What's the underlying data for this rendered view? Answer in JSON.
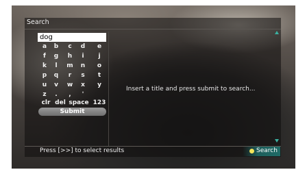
{
  "colors": {
    "accent": "#3bb0a0",
    "submit_gradient": "#8a8a8a",
    "search_dot": "#f3e35a"
  },
  "header": {
    "title": "Search"
  },
  "search": {
    "value": "dog"
  },
  "keyboard": {
    "rows": [
      [
        "a",
        "b",
        "c",
        "d",
        "e"
      ],
      [
        "f",
        "g",
        "h",
        "i",
        "j"
      ],
      [
        "k",
        "l",
        "m",
        "n",
        "o"
      ],
      [
        "p",
        "q",
        "r",
        "s",
        "t"
      ],
      [
        "u",
        "v",
        "w",
        "x",
        "y"
      ],
      [
        "z",
        ".",
        ",",
        "'"
      ],
      [
        "clr",
        "del",
        "space",
        "123"
      ]
    ],
    "submit_label": "Submit"
  },
  "results": {
    "prompt": "Insert a title and press submit to search..."
  },
  "footer": {
    "hint": "Press [>>] to select results",
    "search_label": "Search"
  },
  "icons": {
    "scroll_up": "up-arrow-icon",
    "scroll_down": "down-arrow-icon",
    "search_dot": "yellow-dot-icon"
  }
}
